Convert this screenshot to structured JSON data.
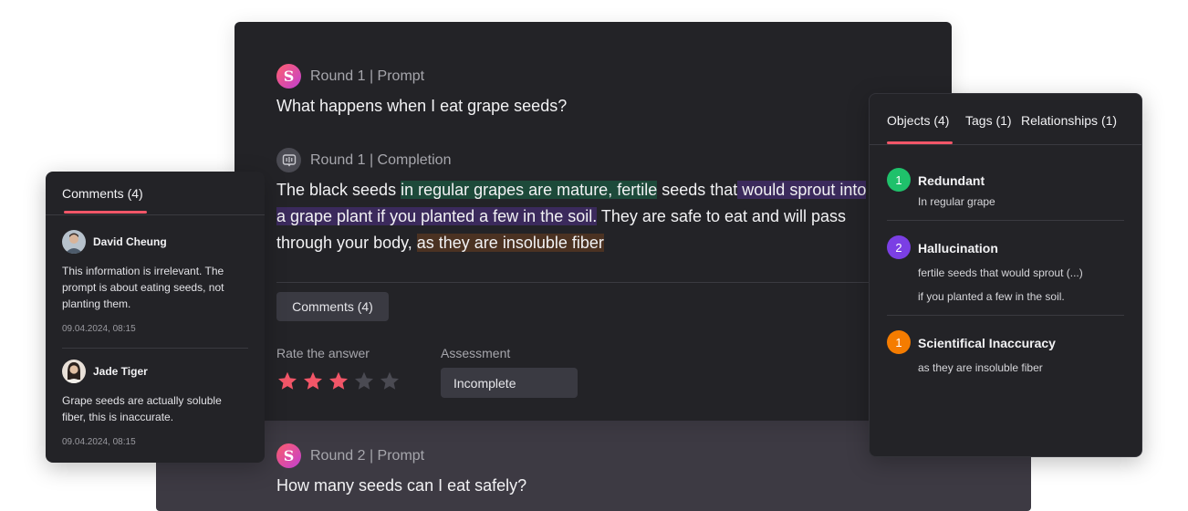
{
  "main": {
    "round1": {
      "prompt_label": "Round 1 | Prompt",
      "prompt_text": "What happens when I eat grape seeds?",
      "completion_label": "Round 1 | Completion",
      "completion_parts": {
        "p1": "The black seeds ",
        "p2": "in regular grapes are mature, fertile",
        "p3": " seeds that",
        "p4": " would sprout into a grape plant if you planted a few in the soil.",
        "p5": " They are safe to eat and will pass through your body, ",
        "p6": "as they are insoluble fiber"
      },
      "comments_button": "Comments (4)",
      "rate_label": "Rate the answer",
      "rating": 3,
      "rating_max": 5,
      "assessment_label": "Assessment",
      "assessment_value": "Incomplete"
    },
    "round2": {
      "prompt_label": "Round 2 | Prompt",
      "prompt_text": "How many seeds can I eat safely?"
    },
    "avatar_letter": "S"
  },
  "comments": {
    "title": "Comments (4)",
    "items": [
      {
        "name": "David Cheung",
        "body": "This information is irrelevant. The prompt is about eating seeds, not planting them.",
        "date": "09.04.2024, 08:15"
      },
      {
        "name": "Jade Tiger",
        "body": "Grape seeds are actually soluble fiber, this is inaccurate.",
        "date": "09.04.2024, 08:15"
      }
    ]
  },
  "objects": {
    "tabs": [
      "Objects (4)",
      "Tags (1)",
      "Relationships (1)"
    ],
    "items": [
      {
        "badge": "1",
        "color": "#1fc16b",
        "title": "Redundant",
        "subs": [
          "In regular grape"
        ]
      },
      {
        "badge": "2",
        "color": "#7b3fe4",
        "title": "Hallucination",
        "subs": [
          "fertile seeds that would sprout (...)",
          "if you planted a few in the soil."
        ]
      },
      {
        "badge": "1",
        "color": "#f57c00",
        "title": "Scientifical Inaccuracy",
        "subs": [
          "as they are insoluble fiber"
        ]
      }
    ]
  },
  "colors": {
    "accent": "#f25668",
    "star_on": "#f25668",
    "star_off": "#4a4a52",
    "highlight_green": "#1d4a3a",
    "highlight_purple": "#3b2a5c",
    "highlight_orange": "#4b3222"
  }
}
